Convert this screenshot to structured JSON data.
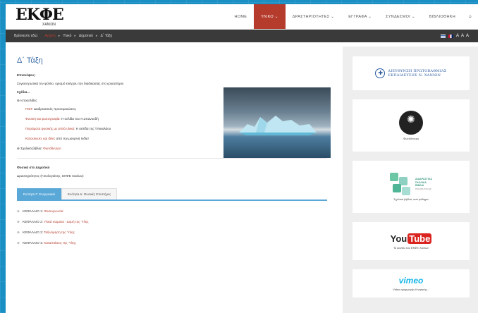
{
  "header": {
    "logo_text": "ΕΚΦΕ",
    "logo_sub": "ΧΑΝΙΩΝ",
    "nav": [
      {
        "label": "HOME",
        "active": false
      },
      {
        "label": "ΥΛΙΚΟ ⌄",
        "active": true
      },
      {
        "label": "ΔΡΑΣΤΗΡΙΟΤΗΤΕΣ ⌄",
        "active": false
      },
      {
        "label": "ΕΓΓΡΑΦΑ ⌄",
        "active": false
      },
      {
        "label": "ΣΥΝΔΕΣΜΟΙ ⌄",
        "active": false
      },
      {
        "label": "ΒΙΒΛΙΟΘΗΚΗ",
        "active": false
      }
    ],
    "search_icon": "search-icon"
  },
  "breadcrumb": {
    "prefix": "Βρίσκεστε εδώ:",
    "items": [
      "Αρχική",
      "Υλικό",
      "Δημοτικό",
      "Δ΄ Τάξη"
    ],
    "font_size_controls": "A A A"
  },
  "main": {
    "title": "Δ΄ Τάξη",
    "episkepsis_label": "Επισκέψεις:",
    "intro_pre": "Συγκεντρωτικά τον φύλλο,",
    "intro_link": "τον φύλλο,",
    "intro_post": "ορισμό ελέγχου την διαδικασίας στο εργαστήριο",
    "sxedia_label": "Σχέδια...",
    "ergasies_label": "Ιστοσελίδες",
    "items": [
      {
        "link": "ΠΙΣΤ:",
        "text": "Διαδραστικές προσομοιώσεις"
      },
      {
        "link": "Φυσική και φωτογραφία:",
        "text": "Η σελίδα του Η.Σπανουδή"
      },
      {
        "link": "Πειράματα φυσικής με απλά υλικά:",
        "text": "Η σελίδα της Τ.Νικολάου"
      },
      {
        "link": "Κατασκευές και ιδέες",
        "text": "από την μακρινή Ινδία!"
      }
    ],
    "extra_label": "Σχολικά βιβλία:",
    "extra_link": "Φωτόδεντρο",
    "fysiki_label": "Φυσικά στο Δημοτικό",
    "fysiki_text": "Δραστηριότητες (Γ.Ευλογιάνης, ΕΚΦΕ Χανίων)",
    "tabs": [
      "Ενότητα Γ: Ενεργειακά",
      "Ενότητα Δ: Φυσικές Επιστήμες"
    ],
    "chapters": [
      {
        "label": "ΚΕΦΑΛΑΙΟ 1:",
        "link": "Φυσιογνωσία"
      },
      {
        "label": "ΚΕΦΑΛΑΙΟ 2:",
        "link": "Υλικά σώματα - Δομή της Ύλης"
      },
      {
        "label": "ΚΕΦΑΛΑΙΟ 3:",
        "link": "Ταξινόμηση της Ύλης"
      },
      {
        "label": "ΚΕΦΑΛΑΙΟ 4:",
        "link": "Καταστάσεις της Ύλης"
      }
    ]
  },
  "sidebar": {
    "directorate_line1": "ΔΙΕΥΘΥΝΣΗ ΠΡΩΤΟΒΑΘΜΙΑΣ",
    "directorate_line2": "ΕΚΠΑΙΔΕΥΣΗΣ Ν. ΧΑΝΙΩΝ",
    "fotodentro_caption": "Φωτόδεντρο",
    "fotodentro_word": "φωτόδεντρο",
    "books_line1": "ΔΙΑΔΡΑΣΤΙΚΑ",
    "books_line2": "ΣΧΟΛΙΚΑ",
    "books_line3": "ΒΙΒΛΙΑ",
    "books_small": "ebooks.edu.gr",
    "books_caption": "Σχολικά βιβλία, ανά μάθημα",
    "youtube_you": "You",
    "youtube_tube": "Tube",
    "youtube_caption": "Το κανάλι του ΕΚΦΕ Χανίων",
    "vimeo_word": "vimeo",
    "vimeo_caption": "Video εφαρμογής Κινητικής..."
  },
  "colors": {
    "accent_red": "#b53b2c",
    "title_blue": "#3d6ea6",
    "tab_blue": "#5aa8d8",
    "background_blue": "#1a8fc4"
  }
}
